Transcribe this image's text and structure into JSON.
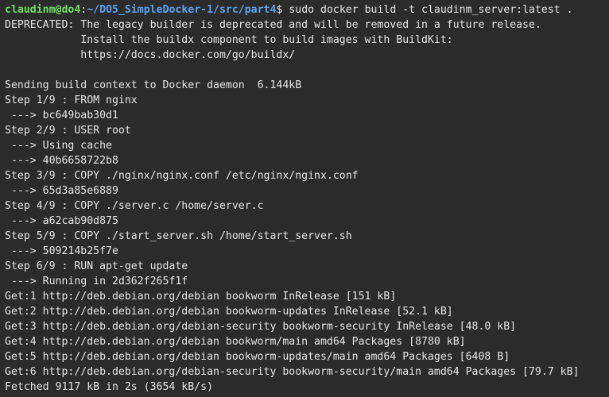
{
  "prompt": {
    "user_host": "claudinm@do4",
    "separator": ":",
    "path": "~/DO5_SimpleDocker-1/src/part4",
    "symbol": "$ ",
    "command": "sudo docker build -t claudinm_server:latest ."
  },
  "colors": {
    "background": "#2b2b2b",
    "text": "#e6e6e6",
    "user_host": "#6ddf62",
    "path": "#5aa3f0"
  },
  "output": [
    "DEPRECATED: The legacy builder is deprecated and will be removed in a future release.",
    "            Install the buildx component to build images with BuildKit:",
    "            https://docs.docker.com/go/buildx/",
    "",
    "Sending build context to Docker daemon  6.144kB",
    "Step 1/9 : FROM nginx",
    " ---> bc649bab30d1",
    "Step 2/9 : USER root",
    " ---> Using cache",
    " ---> 40b6658722b8",
    "Step 3/9 : COPY ./nginx/nginx.conf /etc/nginx/nginx.conf",
    " ---> 65d3a85e6889",
    "Step 4/9 : COPY ./server.c /home/server.c",
    " ---> a62cab90d875",
    "Step 5/9 : COPY ./start_server.sh /home/start_server.sh",
    " ---> 509214b25f7e",
    "Step 6/9 : RUN apt-get update",
    " ---> Running in 2d362f265f1f",
    "Get:1 http://deb.debian.org/debian bookworm InRelease [151 kB]",
    "Get:2 http://deb.debian.org/debian bookworm-updates InRelease [52.1 kB]",
    "Get:3 http://deb.debian.org/debian-security bookworm-security InRelease [48.0 kB]",
    "Get:4 http://deb.debian.org/debian bookworm/main amd64 Packages [8780 kB]",
    "Get:5 http://deb.debian.org/debian bookworm-updates/main amd64 Packages [6408 B]",
    "Get:6 http://deb.debian.org/debian-security bookworm-security/main amd64 Packages [79.7 kB]",
    "Fetched 9117 kB in 2s (3654 kB/s)"
  ]
}
